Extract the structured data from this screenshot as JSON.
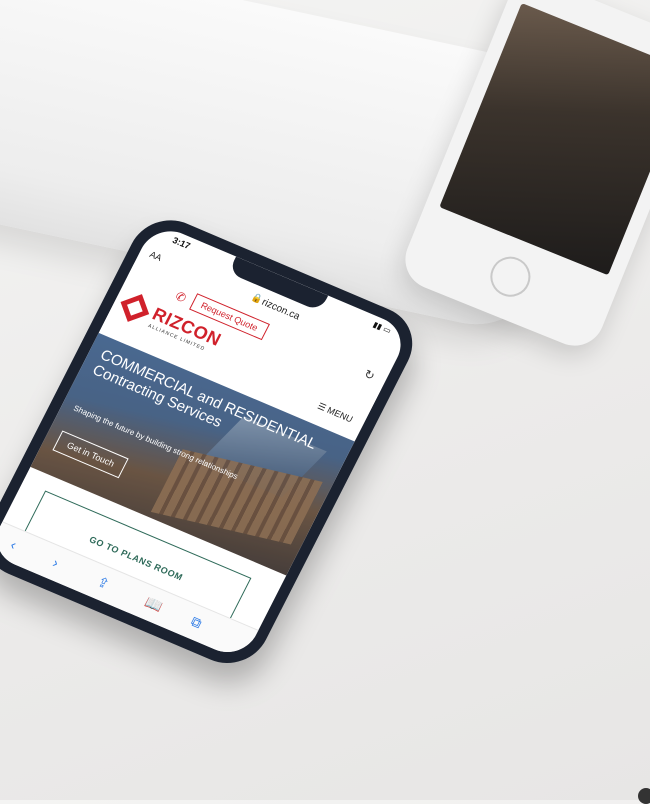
{
  "browser": {
    "time": "3:17",
    "text_size": "AA",
    "url": "rizcon.ca"
  },
  "site": {
    "request_quote": "Request Quote",
    "logo_name": "RIZCON",
    "logo_sub": "ALLIANCE LIMITED",
    "menu": "MENU",
    "hero_title": "COMMERCIAL and RESIDENTIAL Contracting Services",
    "hero_subtitle": "Shaping the future by building strong relationships",
    "cta": "Get in Touch",
    "plans_room": "GO TO PLANS ROOM"
  },
  "colors": {
    "brand_red": "#d0212b",
    "plans_green": "#2f6b5a",
    "phone_case": "#1b2230"
  }
}
